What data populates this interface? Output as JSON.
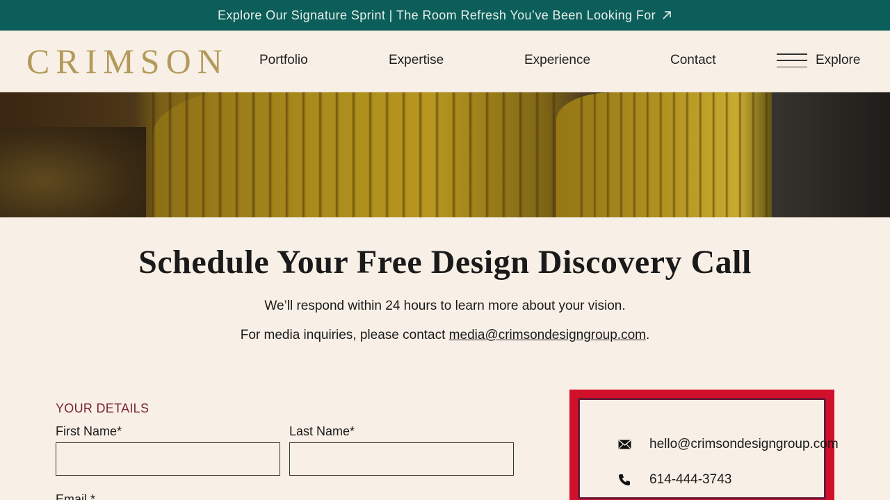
{
  "announcement": {
    "text": "Explore Our Signature Sprint | The Room Refresh You’ve Been Looking For",
    "icon": "arrow-up-right-icon"
  },
  "header": {
    "logo": "CRIMSON",
    "nav": [
      "Portfolio",
      "Expertise",
      "Experience",
      "Contact"
    ],
    "explore_label": "Explore",
    "menu_icon": "hamburger-menu-icon"
  },
  "main": {
    "title": "Schedule Your Free Design Discovery Call",
    "subtitle": "We’ll respond within 24 hours to learn more about your vision.",
    "media_prefix": "For media inquiries, please contact ",
    "media_email": "media@crimsondesigngroup.com",
    "media_suffix": "."
  },
  "form": {
    "section_label": "YOUR DETAILS",
    "first_name_label": "First Name*",
    "last_name_label": "Last Name*",
    "email_label": "Email *",
    "first_name_value": "",
    "last_name_value": ""
  },
  "contact": {
    "email": "hello@crimsondesigngroup.com",
    "phone": "614-444-3743",
    "email_icon": "envelope-icon",
    "phone_icon": "phone-icon"
  },
  "colors": {
    "announcement_bg": "#0b5e5a",
    "page_bg": "#f8f0e6",
    "logo": "#b39a5a",
    "section_label": "#7a2232",
    "highlight_border": "#d1102b"
  }
}
